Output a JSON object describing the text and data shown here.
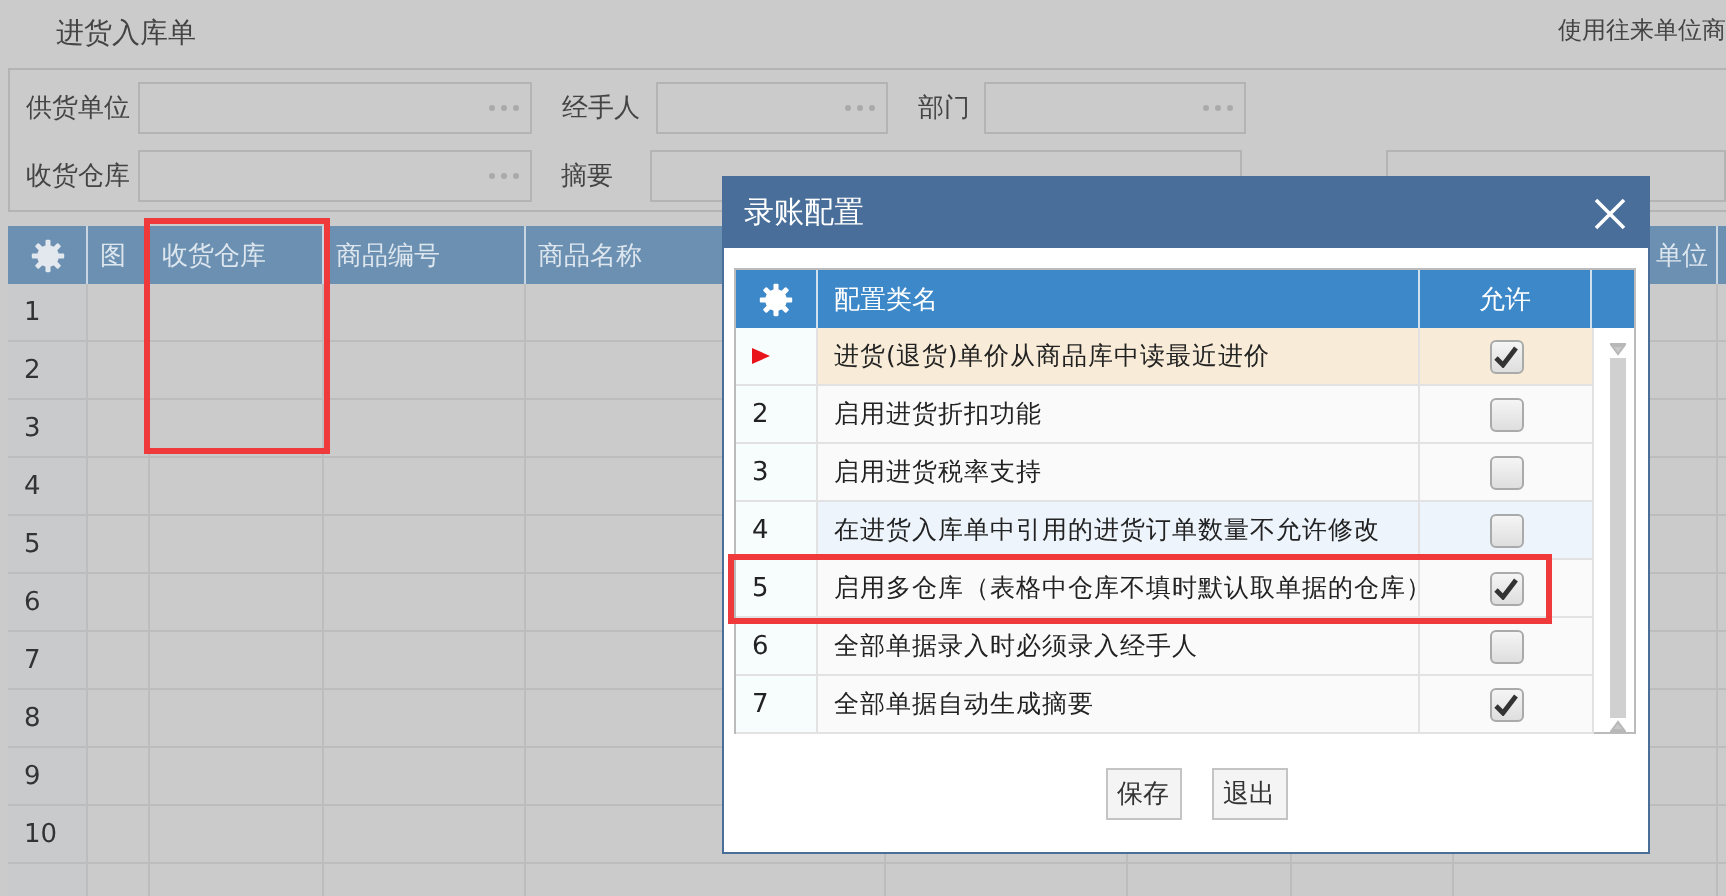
{
  "window": {
    "title": "进货入库单",
    "top_link": "使用往来单位商"
  },
  "form": {
    "rows": [
      [
        {
          "label": "供货单位",
          "kind": "picker"
        },
        {
          "label": "经手人",
          "kind": "picker"
        },
        {
          "label": "部门",
          "kind": "picker"
        }
      ],
      [
        {
          "label": "收货仓库",
          "kind": "picker"
        },
        {
          "label": "摘要",
          "kind": "text"
        },
        {
          "kind": "text"
        }
      ]
    ]
  },
  "grid": {
    "columns": [
      {
        "kind": "settings"
      },
      {
        "kind": "text",
        "label": "图"
      },
      {
        "kind": "text",
        "label": "收货仓库",
        "highlighted": true
      },
      {
        "kind": "text",
        "label": "商品编号"
      },
      {
        "kind": "text",
        "label": "商品名称"
      },
      {
        "kind": "covered"
      },
      {
        "kind": "covered"
      },
      {
        "kind": "covered"
      },
      {
        "kind": "text",
        "label": "单位"
      }
    ],
    "rows": [
      {
        "number": "1",
        "highlighted": true
      },
      {
        "number": "2",
        "highlighted": true
      },
      {
        "number": "3",
        "highlighted": true
      },
      {
        "number": "4"
      },
      {
        "number": "5"
      },
      {
        "number": "6"
      },
      {
        "number": "7"
      },
      {
        "number": "8"
      },
      {
        "number": "9"
      },
      {
        "number": "10"
      }
    ]
  },
  "dialog": {
    "title": "录账配置",
    "columns": [
      {
        "kind": "settings"
      },
      {
        "kind": "text",
        "label": "配置类名"
      },
      {
        "kind": "text",
        "label": "允许"
      }
    ],
    "rows": [
      {
        "name": "进货(退货)单价从商品库中读最近进价",
        "allowed": true,
        "selected": true
      },
      {
        "number": "2",
        "name": "启用进货折扣功能",
        "allowed": false,
        "selected": false
      },
      {
        "number": "3",
        "name": "启用进货税率支持",
        "allowed": false,
        "selected": false
      },
      {
        "number": "4",
        "name": "在进货入库单中引用的进货订单数量不允许修改",
        "allowed": false,
        "selected": false,
        "hovered": true
      },
      {
        "number": "5",
        "name": "启用多仓库（表格中仓库不填时默认取单据的仓库）",
        "allowed": true,
        "selected": false,
        "highlighted": true
      },
      {
        "number": "6",
        "name": "全部单据录入时必须录入经手人",
        "allowed": false,
        "selected": false
      },
      {
        "number": "7",
        "name": "全部单据自动生成摘要",
        "allowed": true,
        "selected": false
      }
    ],
    "buttons": [
      "保存",
      "退出"
    ]
  }
}
